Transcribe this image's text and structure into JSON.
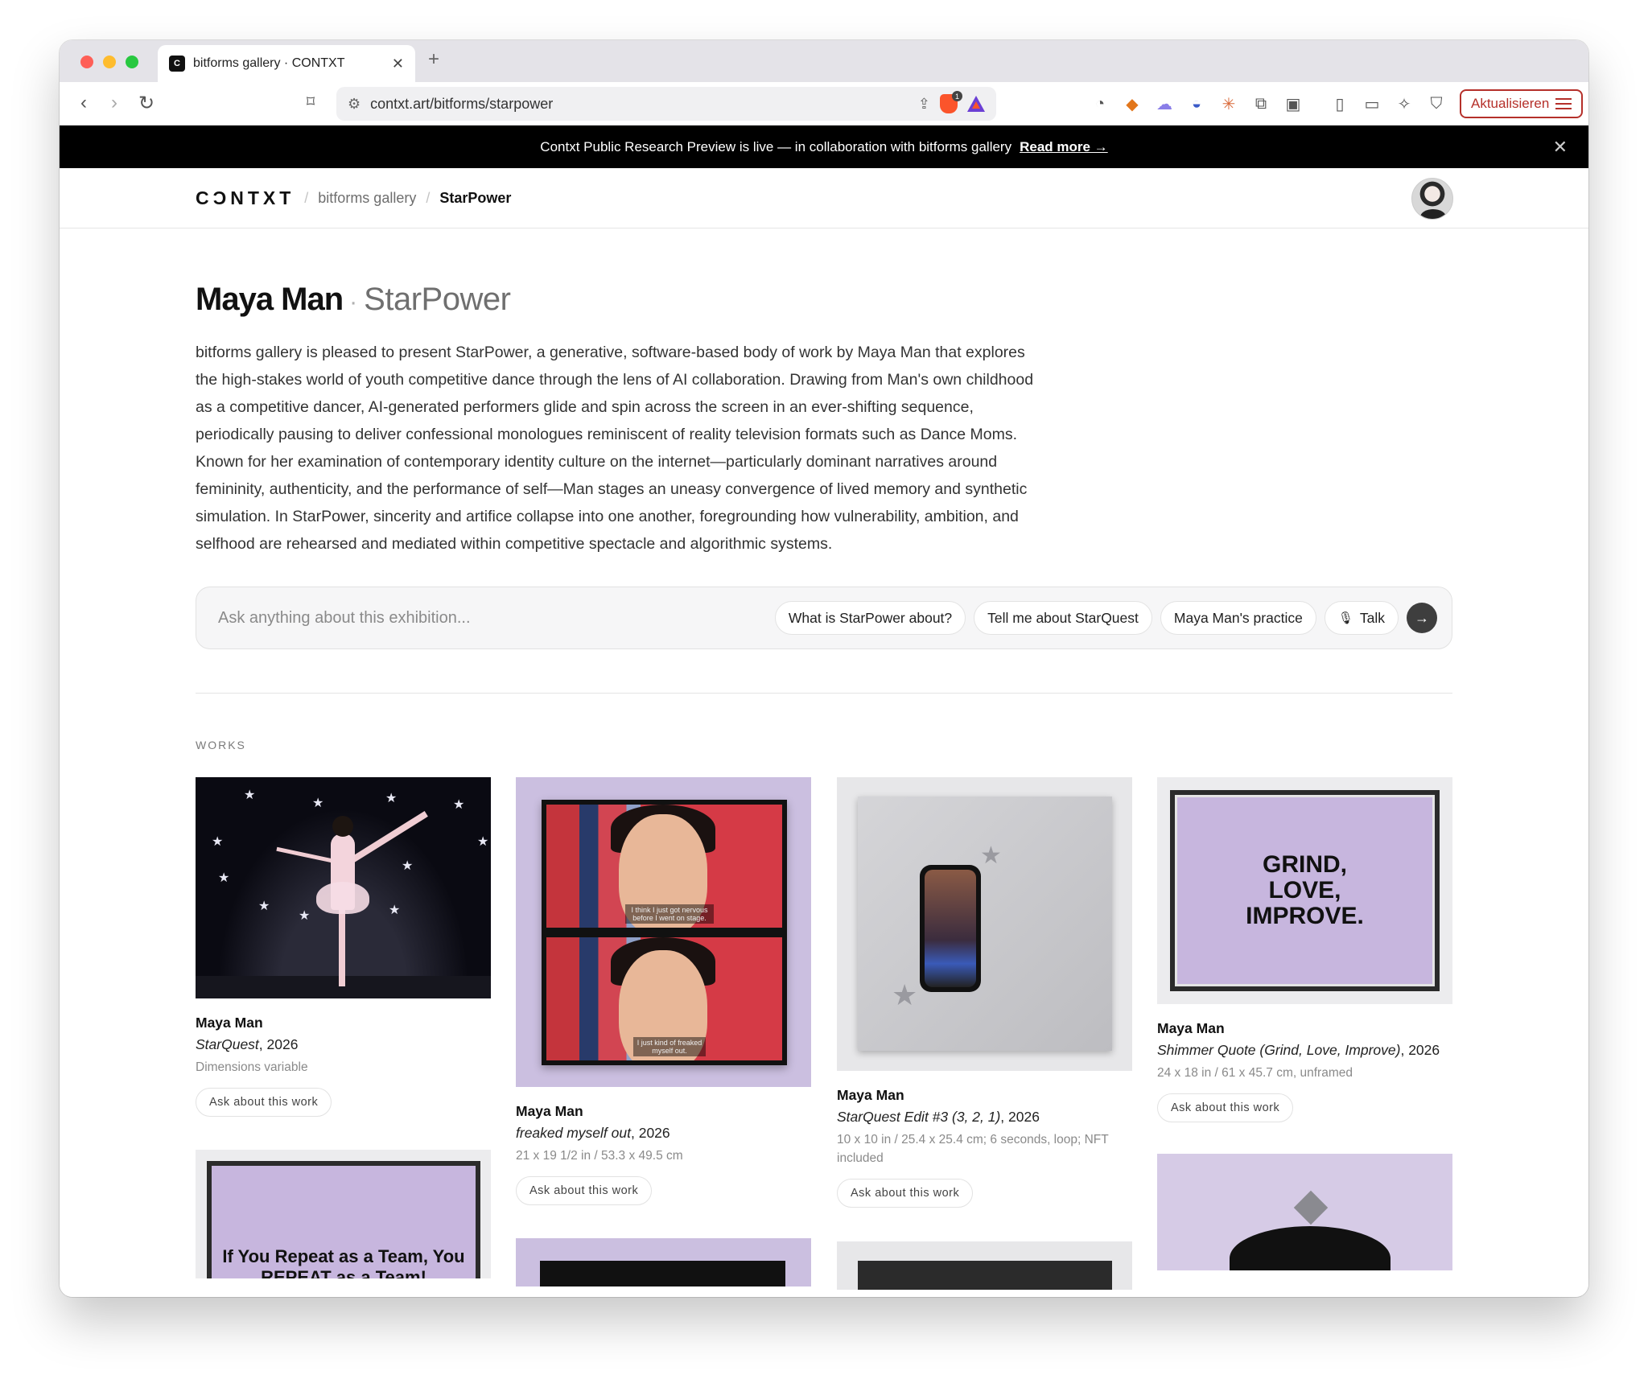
{
  "browser": {
    "tab_title": "bitforms gallery · CONTXT",
    "tab_favicon": "C",
    "url": "contxt.art/bitforms/starpower",
    "brave_shield_count": "1",
    "update_label": "Aktualisieren"
  },
  "banner": {
    "text": "Contxt Public Research Preview is live — in collaboration with bitforms gallery",
    "link": "Read more →"
  },
  "header": {
    "logo": "CƆNTXT",
    "crumbs": [
      "bitforms gallery",
      "StarPower"
    ],
    "separator": "/"
  },
  "exhibition": {
    "artist": "Maya Man",
    "dot": "·",
    "title": "StarPower",
    "description": "bitforms gallery is pleased to present StarPower, a generative, software-based body of work by Maya Man that explores the high-stakes world of youth competitive dance through the lens of AI collaboration. Drawing from Man's own childhood as a competitive dancer, AI-generated performers glide and spin across the screen in an ever-shifting sequence, periodically pausing to deliver confessional monologues reminiscent of reality television formats such as Dance Moms. Known for her examination of contemporary identity culture on the internet—particularly dominant narratives around femininity, authenticity, and the performance of self—Man stages an uneasy convergence of lived memory and synthetic simulation. In StarPower, sincerity and artifice collapse into one another, foregrounding how vulnerability, ambition, and selfhood are rehearsed and mediated within competitive spectacle and algorithmic systems."
  },
  "ask": {
    "placeholder": "Ask anything about this exhibition...",
    "chips": [
      "What is StarPower about?",
      "Tell me about StarQuest",
      "Maya Man's practice"
    ],
    "talk_label": "Talk"
  },
  "works": {
    "label": "WORKS",
    "ask_label": "Ask about this work",
    "items": [
      {
        "artist": "Maya Man",
        "title": "StarQuest",
        "year": ", 2026",
        "dims": "Dimensions variable"
      },
      {
        "artist": "Maya Man",
        "title": "freaked myself out",
        "year": ", 2026",
        "dims": "21 x 19 1/2 in / 53.3 x 49.5 cm",
        "caption1": "I think I just got nervous before I went on stage.",
        "caption2": "I just kind of freaked myself out."
      },
      {
        "artist": "Maya Man",
        "title": "StarQuest Edit #3 (3, 2, 1)",
        "year": ", 2026",
        "dims": "10 x 10 in / 25.4 x 25.4 cm; 6 seconds, loop; NFT included"
      },
      {
        "artist": "Maya Man",
        "title": "Shimmer Quote (Grind, Love, Improve)",
        "year": ", 2026",
        "dims": "24 x 18 in / 61 x 45.7 cm, unframed",
        "quote": "GRIND, LOVE, IMPROVE."
      },
      {
        "quote": "If You Repeat as a Team, You REPEAT as a Team!"
      }
    ]
  }
}
